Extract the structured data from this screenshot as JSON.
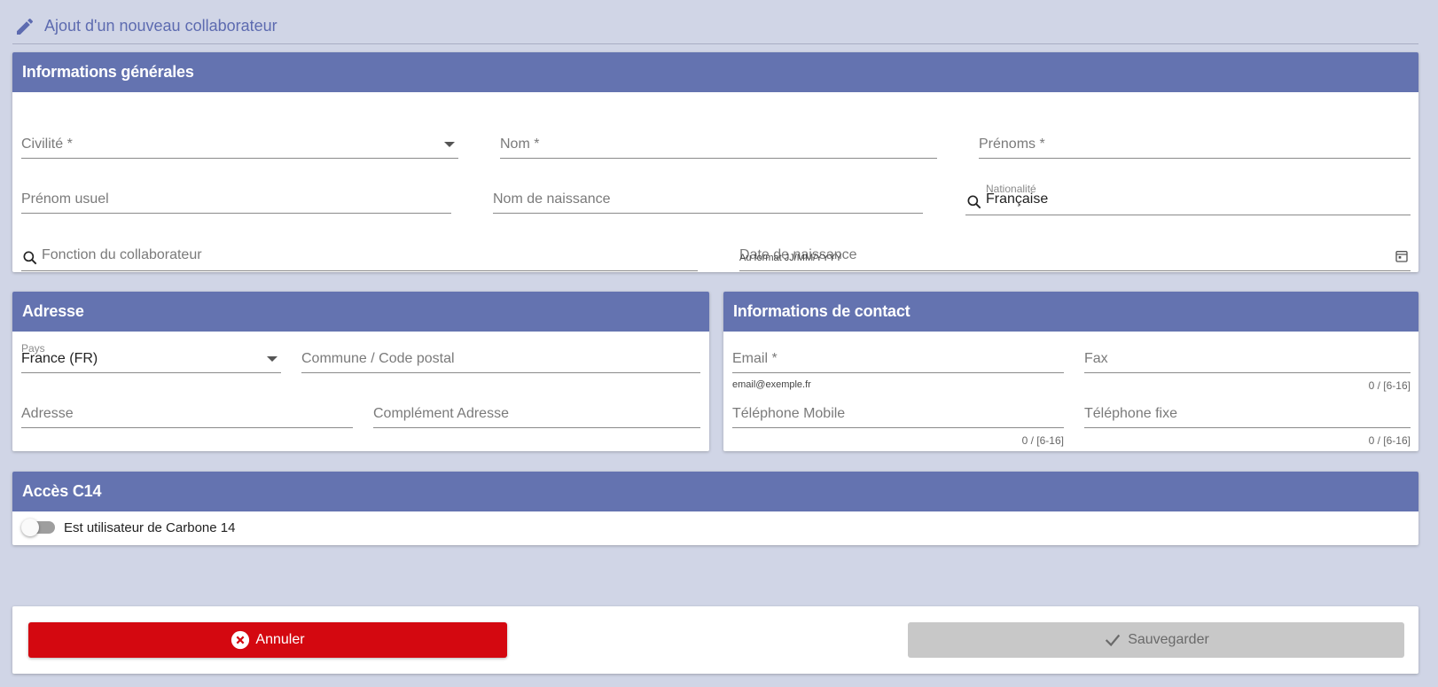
{
  "page": {
    "title": "Ajout d'un nouveau collaborateur",
    "icon": "pencil-icon"
  },
  "general": {
    "header": "Informations générales",
    "civilite": {
      "placeholder": "Civilité *",
      "value": ""
    },
    "nom": {
      "placeholder": "Nom *",
      "value": ""
    },
    "prenoms": {
      "placeholder": "Prénoms *",
      "value": ""
    },
    "prenom_usuel": {
      "placeholder": "Prénom usuel",
      "value": ""
    },
    "nom_naissance": {
      "placeholder": "Nom de naissance",
      "value": ""
    },
    "nationalite": {
      "label": "Nationalité",
      "value": "Française"
    },
    "fonction": {
      "placeholder": "Fonction du collaborateur",
      "value": ""
    },
    "date_naissance": {
      "placeholder": "Date de naissance",
      "hint": "Au format JJ/MM/YYYY"
    }
  },
  "adresse": {
    "header": "Adresse",
    "pays": {
      "label": "Pays",
      "value": "France (FR)"
    },
    "commune": {
      "placeholder": "Commune / Code postal"
    },
    "adresse": {
      "placeholder": "Adresse"
    },
    "complement": {
      "placeholder": "Complément Adresse"
    }
  },
  "contact": {
    "header": "Informations de contact",
    "email": {
      "placeholder": "Email *",
      "hint": "email@exemple.fr"
    },
    "fax": {
      "placeholder": "Fax",
      "counter": "0 / [6-16]"
    },
    "mobile": {
      "placeholder": "Téléphone Mobile",
      "counter": "0 / [6-16]"
    },
    "fixe": {
      "placeholder": "Téléphone fixe",
      "counter": "0 / [6-16]"
    }
  },
  "acces": {
    "header": "Accès C14",
    "toggle_label": "Est utilisateur de Carbone 14",
    "toggle_on": false
  },
  "actions": {
    "cancel_label": "Annuler",
    "save_label": "Sauvegarder"
  },
  "colors": {
    "header_bg": "#6473b0",
    "page_bg": "#d0d5e6",
    "cancel_bg": "#d40810",
    "save_bg": "#c8c8c8"
  }
}
